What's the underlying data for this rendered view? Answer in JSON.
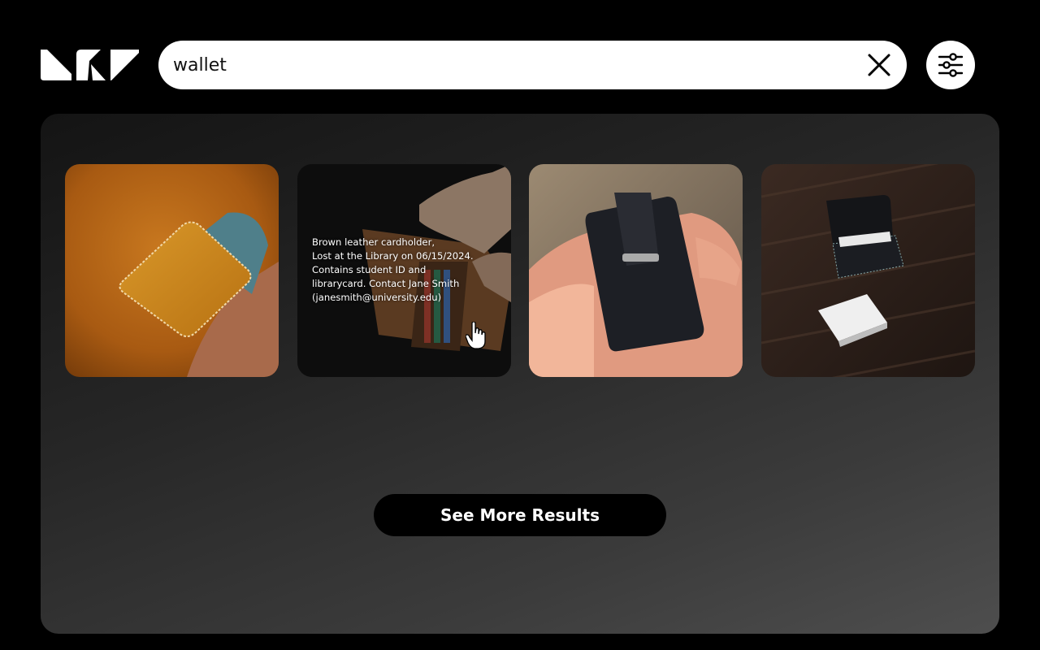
{
  "header": {
    "logo_icon": "brand-logo",
    "search": {
      "value": "wallet",
      "placeholder": "",
      "clear_icon": "close-icon"
    },
    "filter_icon": "sliders-icon"
  },
  "results": {
    "items": [
      {
        "image": "yellow leather cardholder on tan leather"
      },
      {
        "image": "hand holding open brown leather wallet",
        "details": [
          "Brown leather cardholder,",
          "Lost at the Library on 06/15/2024.",
          "Contains student ID and",
          "librarycard. Contact Jane Smith",
          "(janesmith@university.edu)"
        ]
      },
      {
        "image": "hand holding black metal card wallet with money clip"
      },
      {
        "image": "black card case with white cards on wooden table"
      }
    ],
    "see_more_label": "See More Results"
  },
  "colors": {
    "background": "#000000",
    "panel_start": "#141414",
    "panel_end": "#4e4e4e",
    "button_bg": "#000000",
    "text_light": "#ffffff"
  }
}
